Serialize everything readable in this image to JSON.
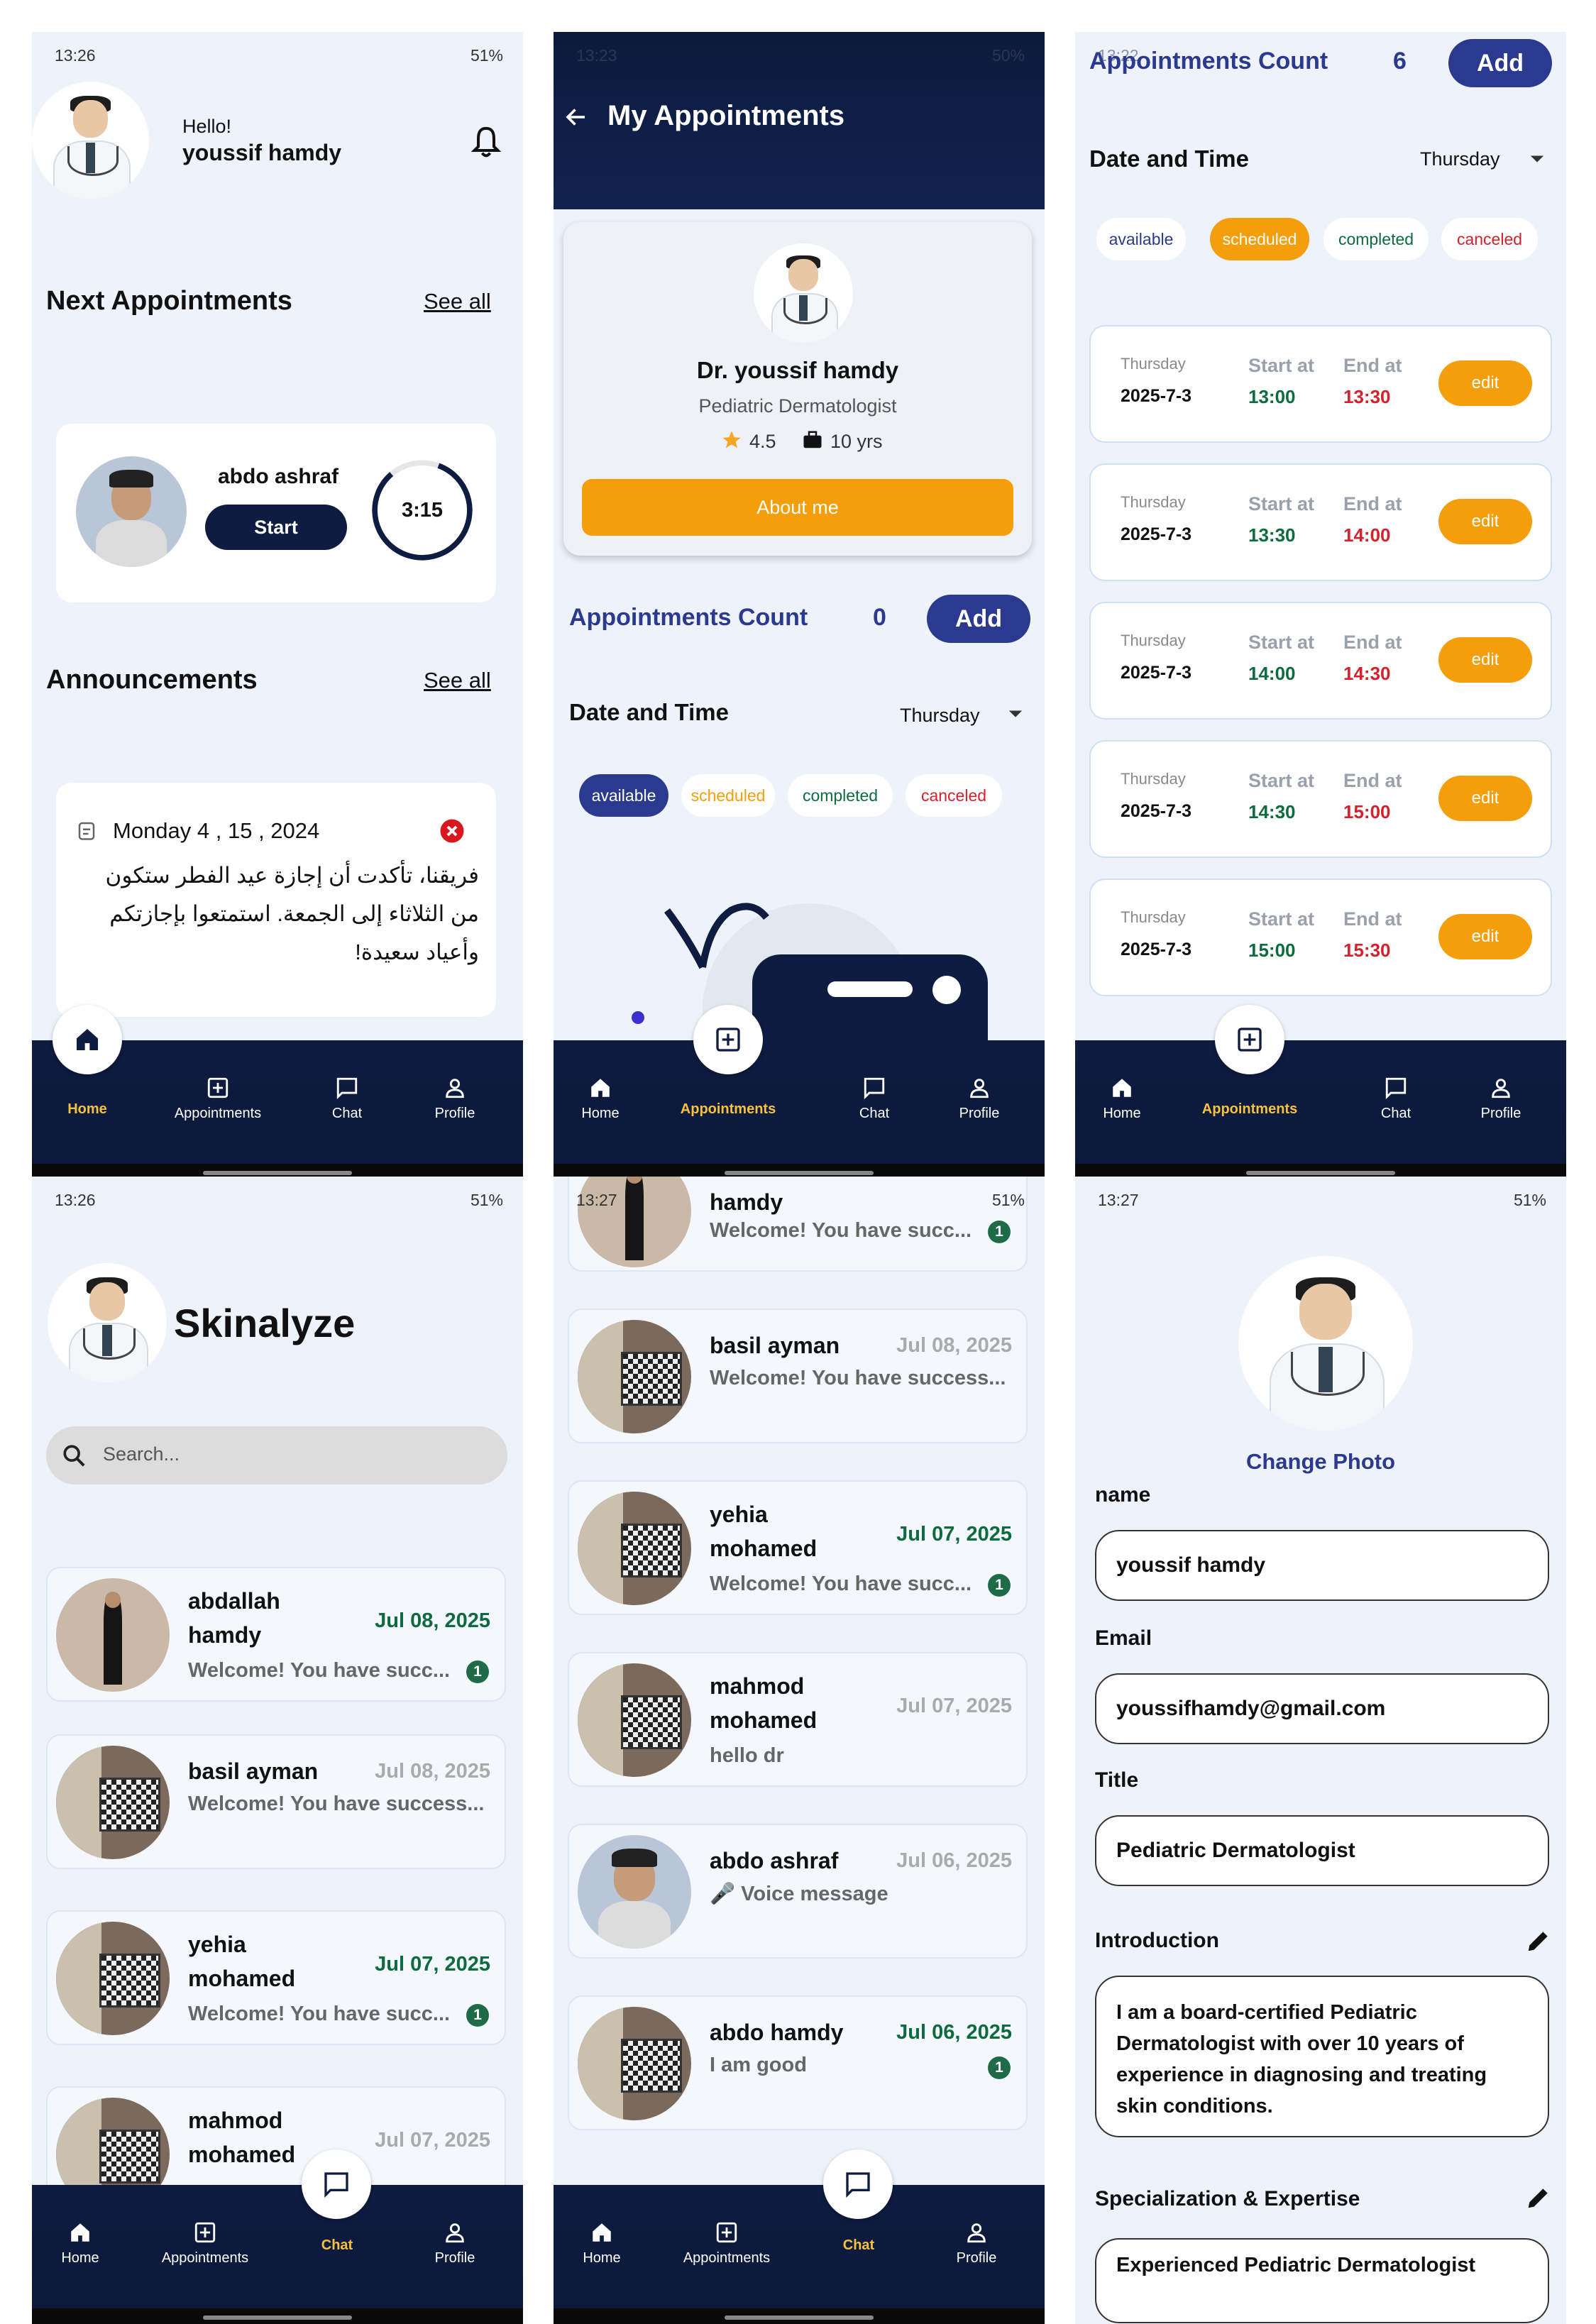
{
  "status_bars": {
    "s1": {
      "time": "13:26",
      "right": "51%"
    },
    "s2": {
      "time": "13:23",
      "right": "50%"
    },
    "s3": {
      "time": "13:22",
      "right": "51%"
    },
    "s4": {
      "time": "13:26",
      "right": "51%"
    },
    "s5": {
      "time": "13:27",
      "right": "51%"
    },
    "s6": {
      "time": "13:27",
      "right": "51%"
    }
  },
  "nav": {
    "home": "Home",
    "appointments": "Appointments",
    "chat": "Chat",
    "profile": "Profile"
  },
  "home": {
    "greeting": "Hello!",
    "user_name": "youssif hamdy",
    "next_title": "Next Appointments",
    "see_all": "See all",
    "patient_name": "abdo ashraf",
    "start_label": "Start",
    "timer": "3:15",
    "announcements_title": "Announcements",
    "announce_date": "Monday  4 , 15 , 2024",
    "announce_text": "فريقنا، تأكدت أن إجازة عيد الفطر ستكون من الثلاثاء إلى الجمعة. استمتعوا بإجازتكم وأعياد سعيدة!"
  },
  "appointments": {
    "title": "My Appointments",
    "doctor_name": "Dr. youssif hamdy",
    "specialty": "Pediatric Dermatologist",
    "rating": "4.5",
    "experience": "10 yrs",
    "about_label": "About me",
    "count_label": "Appointments Count",
    "count_value": "0",
    "add_label": "Add",
    "date_time_label": "Date and Time",
    "day_select": "Thursday",
    "chips": [
      "available",
      "scheduled",
      "completed",
      "canceled"
    ]
  },
  "schedule": {
    "count_label": "Appointments Count",
    "count_value": "6",
    "add_label": "Add",
    "date_time_label": "Date and Time",
    "day_select": "Thursday",
    "chips": [
      "available",
      "scheduled",
      "completed",
      "canceled"
    ],
    "start_label": "Start at",
    "end_label": "End at",
    "edit_label": "edit",
    "slots": [
      {
        "day": "Thursday",
        "date": "2025-7-3",
        "start": "13:00",
        "end": "13:30"
      },
      {
        "day": "Thursday",
        "date": "2025-7-3",
        "start": "13:30",
        "end": "14:00"
      },
      {
        "day": "Thursday",
        "date": "2025-7-3",
        "start": "14:00",
        "end": "14:30"
      },
      {
        "day": "Thursday",
        "date": "2025-7-3",
        "start": "14:30",
        "end": "15:00"
      },
      {
        "day": "Thursday",
        "date": "2025-7-3",
        "start": "15:00",
        "end": "15:30"
      }
    ]
  },
  "chat_list": {
    "app_title": "Skinalyze",
    "search_placeholder": "Search...",
    "chats": [
      {
        "name": "abdallah hamdy",
        "date": "Jul 08, 2025",
        "msg": "Welcome! You have succ...",
        "badge": "1"
      },
      {
        "name": "basil ayman",
        "date": "Jul 08, 2025",
        "msg": "Welcome! You have success...",
        "badge": ""
      },
      {
        "name": "yehia mohamed",
        "date": "Jul 07, 2025",
        "msg": "Welcome! You have succ...",
        "badge": "1"
      },
      {
        "name": "mahmod mohamed",
        "date": "Jul 07, 2025",
        "msg": "",
        "badge": ""
      }
    ]
  },
  "chat_list2": {
    "chats": [
      {
        "name": "hamdy",
        "date": "",
        "msg": "Welcome! You have succ...",
        "badge": "1"
      },
      {
        "name": "basil ayman",
        "date": "Jul 08, 2025",
        "msg": "Welcome! You have success...",
        "badge": ""
      },
      {
        "name": "yehia mohamed",
        "date": "Jul 07, 2025",
        "msg": "Welcome! You have succ...",
        "badge": "1"
      },
      {
        "name": "mahmod mohamed",
        "date": "Jul 07, 2025",
        "msg": "hello dr",
        "badge": ""
      },
      {
        "name": "abdo ashraf",
        "date": "Jul 06, 2025",
        "msg": "🎤 Voice message",
        "badge": ""
      },
      {
        "name": "abdo hamdy",
        "date": "Jul 06, 2025",
        "msg": "I am good",
        "badge": "1"
      }
    ]
  },
  "profile": {
    "change_photo": "Change Photo",
    "name_label": "name",
    "name_value": "youssif hamdy",
    "email_label": "Email",
    "email_value": "youssifhamdy@gmail.com",
    "title_label": "Title",
    "title_value": "Pediatric Dermatologist",
    "intro_label": "Introduction",
    "intro_value": "I am a board-certified Pediatric Dermatologist with over 10 years of experience in diagnosing and treating skin conditions.",
    "spec_label": "Specialization & Expertise",
    "spec_value": "Experienced Pediatric Dermatologist"
  },
  "colors": {
    "navy": "#0e1c42",
    "orange": "#f59e0b",
    "accent_blue": "#2b3a8f",
    "green": "#0d6b3d",
    "red": "#d2222c"
  }
}
